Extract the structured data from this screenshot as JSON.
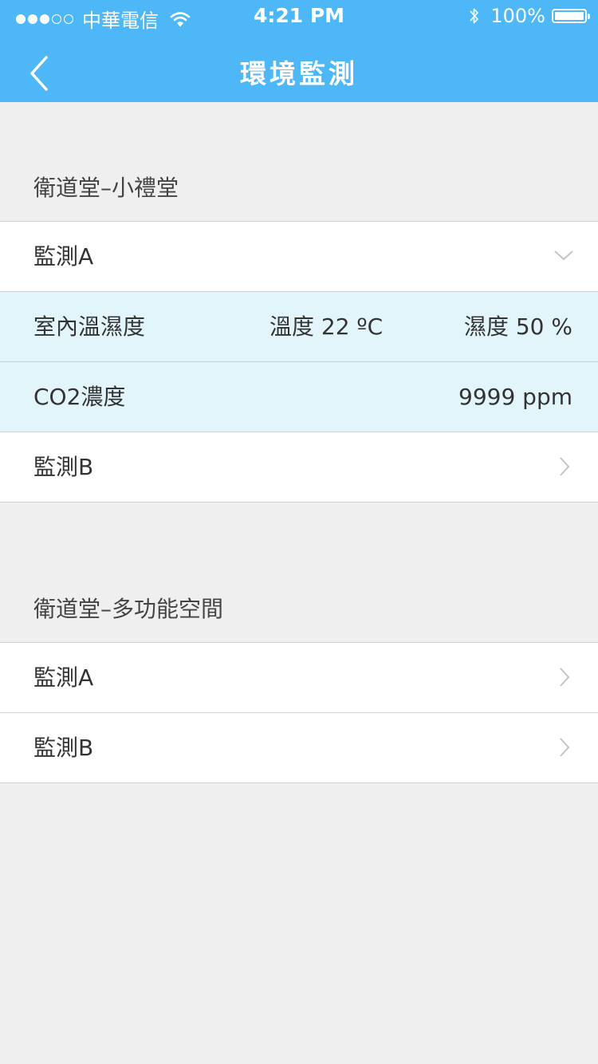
{
  "status_bar": {
    "carrier": "中華電信",
    "time": "4:21 PM",
    "battery": "100%"
  },
  "nav": {
    "title": "環境監測"
  },
  "sections": [
    {
      "title": "衛道堂–小禮堂",
      "monitor_a": {
        "label": "監測A",
        "expanded": true
      },
      "temp_humidity": {
        "label": "室內溫濕度",
        "temperature": "溫度 22 ºC",
        "humidity": "濕度 50 %"
      },
      "co2": {
        "label": "CO2濃度",
        "value": "9999 ppm"
      },
      "monitor_b": {
        "label": "監測B"
      }
    },
    {
      "title": "衛道堂–多功能空間",
      "monitor_a": {
        "label": "監測A"
      },
      "monitor_b": {
        "label": "監測B"
      }
    }
  ],
  "colors": {
    "header": "#4db7f8",
    "background": "#efeff0",
    "expanded_row": "#e2f5fb"
  }
}
